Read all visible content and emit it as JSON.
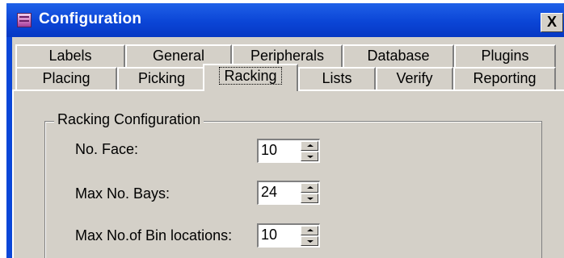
{
  "window": {
    "title": "Configuration",
    "close_label": "X",
    "icon": "app-window-icon"
  },
  "tabs": {
    "back_row": [
      "Labels",
      "General",
      "Peripherals",
      "Database",
      "Plugins"
    ],
    "front_row": [
      "Placing",
      "Picking",
      "Racking",
      "Lists",
      "Verify",
      "Reporting"
    ],
    "active": "Racking"
  },
  "racking": {
    "group_title": "Racking Configuration",
    "fields": [
      {
        "label": "No. Face:",
        "value": "10"
      },
      {
        "label": "Max No. Bays:",
        "value": "24"
      },
      {
        "label": "Max No.of Bin locations:",
        "value": "10"
      }
    ]
  },
  "colors": {
    "titlebar": "#0b45d6",
    "face": "#d4d0c8"
  }
}
